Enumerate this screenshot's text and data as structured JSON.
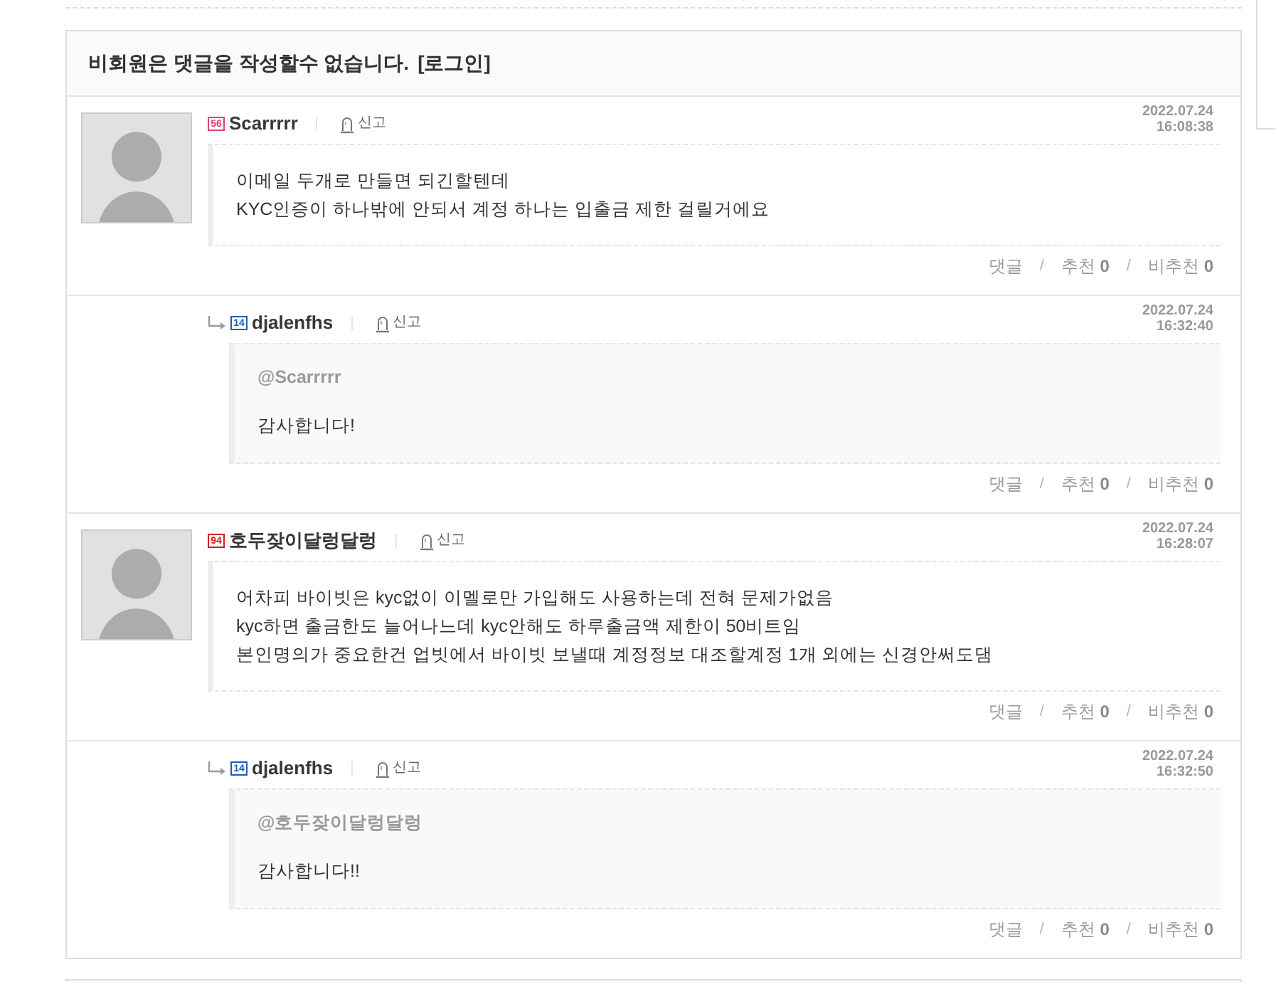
{
  "notice": {
    "text": "비회원은 댓글을 작성할수 없습니다.",
    "login": "[로그인]"
  },
  "comments": [
    {
      "kind": "comment",
      "badge": {
        "text": "56",
        "color": "#e0407a"
      },
      "author": "Scarrrrr",
      "report": "신고",
      "date": "2022.07.24",
      "time": "16:08:38",
      "lines": [
        "이메일 두개로 만들면 되긴할텐데",
        "KYC인증이 하나밖에 안되서 계정 하나는 입출금 제한 걸릴거에요"
      ],
      "actions": [
        {
          "kind": "link",
          "label": "댓글"
        },
        {
          "kind": "separator",
          "text": "/"
        },
        {
          "kind": "vote",
          "label": "추천",
          "count": "0"
        },
        {
          "kind": "separator",
          "text": "/"
        },
        {
          "kind": "vote",
          "label": "비추천",
          "count": "0"
        }
      ]
    },
    {
      "kind": "reply",
      "badge": {
        "text": "14",
        "color": "#1a5fb4"
      },
      "author": "djalenfhs",
      "report": "신고",
      "date": "2022.07.24",
      "time": "16:32:40",
      "mention": "@Scarrrrr",
      "lines": [
        "감사합니다!"
      ],
      "actions": [
        {
          "kind": "link",
          "label": "댓글"
        },
        {
          "kind": "separator",
          "text": "/"
        },
        {
          "kind": "vote",
          "label": "추천",
          "count": "0"
        },
        {
          "kind": "separator",
          "text": "/"
        },
        {
          "kind": "vote",
          "label": "비추천",
          "count": "0"
        }
      ]
    },
    {
      "kind": "comment",
      "badge": {
        "text": "94",
        "color": "#d21f1f"
      },
      "author": "호두잦이달렁달렁",
      "report": "신고",
      "date": "2022.07.24",
      "time": "16:28:07",
      "lines": [
        "어차피 바이빗은 kyc없이 이멜로만 가입해도 사용하는데 전혀 문제가없음",
        "kyc하면 출금한도 늘어나느데 kyc안해도 하루출금액 제한이 50비트임",
        "본인명의가 중요한건 업빗에서 바이빗 보낼때 계정정보 대조할계정 1개 외에는 신경안써도댐"
      ],
      "actions": [
        {
          "kind": "link",
          "label": "댓글"
        },
        {
          "kind": "separator",
          "text": "/"
        },
        {
          "kind": "vote",
          "label": "추천",
          "count": "0"
        },
        {
          "kind": "separator",
          "text": "/"
        },
        {
          "kind": "vote",
          "label": "비추천",
          "count": "0"
        }
      ]
    },
    {
      "kind": "reply",
      "badge": {
        "text": "14",
        "color": "#1a5fb4"
      },
      "author": "djalenfhs",
      "report": "신고",
      "date": "2022.07.24",
      "time": "16:32:50",
      "mention": "@호두잦이달렁달렁",
      "lines": [
        "감사합니다!!"
      ],
      "actions": [
        {
          "kind": "link",
          "label": "댓글"
        },
        {
          "kind": "separator",
          "text": "/"
        },
        {
          "kind": "vote",
          "label": "추천",
          "count": "0"
        },
        {
          "kind": "separator",
          "text": "/"
        },
        {
          "kind": "vote",
          "label": "비추천",
          "count": "0"
        }
      ]
    }
  ]
}
